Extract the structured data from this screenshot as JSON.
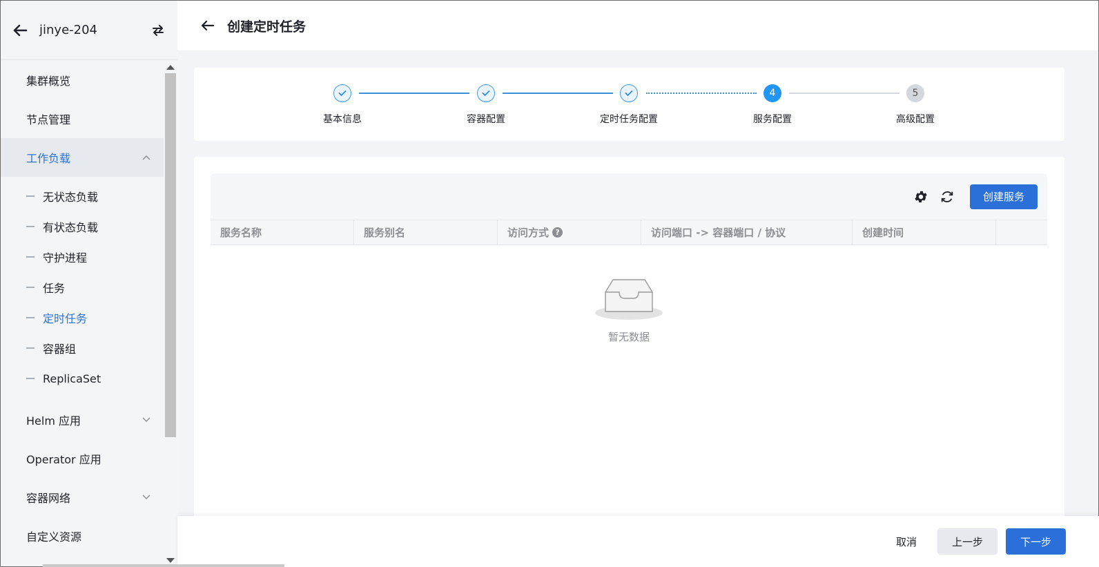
{
  "sidebar": {
    "cluster_name": "jinye-204",
    "menu": [
      {
        "label": "集群概览"
      },
      {
        "label": "节点管理"
      },
      {
        "label": "工作负载"
      },
      {
        "label": "Helm 应用"
      },
      {
        "label": "Operator 应用"
      },
      {
        "label": "容器网络"
      },
      {
        "label": "自定义资源"
      }
    ],
    "workload_sub": [
      {
        "label": "无状态负载"
      },
      {
        "label": "有状态负载"
      },
      {
        "label": "守护进程"
      },
      {
        "label": "任务"
      },
      {
        "label": "定时任务"
      },
      {
        "label": "容器组"
      },
      {
        "label": "ReplicaSet"
      }
    ]
  },
  "page": {
    "title": "创建定时任务"
  },
  "steps": [
    {
      "label": "基本信息",
      "status": "done",
      "number": "1"
    },
    {
      "label": "容器配置",
      "status": "done",
      "number": "2"
    },
    {
      "label": "定时任务配置",
      "status": "done",
      "number": "3"
    },
    {
      "label": "服务配置",
      "status": "current",
      "number": "4"
    },
    {
      "label": "高级配置",
      "status": "todo",
      "number": "5"
    }
  ],
  "table": {
    "create_button": "创建服务",
    "columns": [
      "服务名称",
      "服务别名",
      "访问方式",
      "访问端口 -> 容器端口 / 协议",
      "创建时间",
      ""
    ],
    "help_icon": "?",
    "empty_text": "暂无数据"
  },
  "footer": {
    "cancel": "取消",
    "prev": "上一步",
    "next": "下一步"
  },
  "colors": {
    "primary": "#2a70d8",
    "active_text": "#2b74d6",
    "step_current": "#2196f3"
  }
}
